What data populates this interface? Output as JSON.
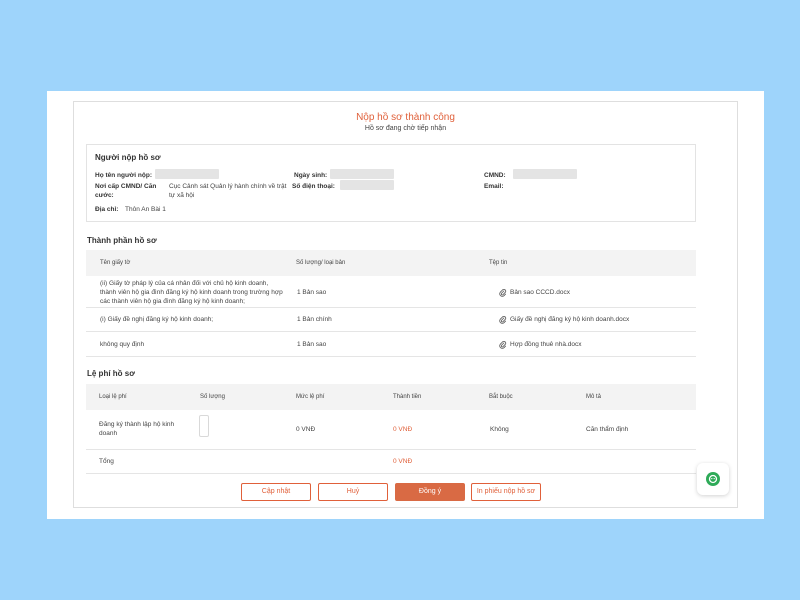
{
  "header": {
    "title": "Nộp hồ sơ thành công",
    "subtitle": "Hồ sơ đang chờ tiếp nhận"
  },
  "applicant": {
    "heading": "Người nộp hồ sơ",
    "name_label": "Họ tên người nộp:",
    "dob_label": "Ngày sinh:",
    "id_label": "CMND:",
    "issuer_label": "Nơi cấp CMND/ Căn cước:",
    "issuer_value": "Cục Cảnh sát Quản lý hành chính về trật tự xã hội",
    "phone_label": "Số điện thoại:",
    "email_label": "Email:",
    "address_label": "Địa chỉ:",
    "address_value": "Thôn An Bài 1"
  },
  "documents": {
    "heading": "Thành phần hồ sơ",
    "columns": [
      "Tên giấy tờ",
      "Số lượng/ loại bản",
      "Tệp tin"
    ],
    "rows": [
      {
        "name": "(ii) Giấy tờ pháp lý của cá nhân đối với chủ hộ kinh doanh, thành viên hộ gia đình đăng ký hộ kinh doanh trong trường hợp các thành viên hộ gia đình đăng ký hộ kinh doanh;",
        "name_line1": "(ii) Giấy tờ pháp lý của cá nhân đối với chủ hộ kinh doanh,",
        "name_line2": "thành viên hộ gia đình đăng ký hộ kinh doanh trong trường hợp",
        "name_line3": "các thành viên hộ gia đình đăng ký hộ kinh doanh;",
        "quantity": "1 Bản sao",
        "file": "Bản sao CCCD.docx"
      },
      {
        "name": "(i) Giấy đề nghị đăng ký hộ kinh doanh;",
        "quantity": "1 Bản chính",
        "file": "Giấy đề nghị đăng ký hộ kinh doanh.docx"
      },
      {
        "name": "không quy định",
        "quantity": "1 Bản sao",
        "file": "Hợp đồng thuê nhà.docx"
      }
    ]
  },
  "fees": {
    "heading": "Lệ phí hồ sơ",
    "columns": [
      "Loại lệ phí",
      "Số lượng",
      "Mức lệ phí",
      "Thành tiền",
      "Bắt buộc",
      "Mô tả"
    ],
    "row": {
      "type_line1": "Đăng ký thành lập hộ kinh",
      "type_line2": "doanh",
      "rate": "0 VNĐ",
      "amount": "0 VNĐ",
      "required": "Không",
      "description": "Căn thẩm định"
    },
    "total_label": "Tổng",
    "total_value": "0 VNĐ"
  },
  "actions": {
    "update": "Cập nhật",
    "cancel": "Huỷ",
    "agree": "Đồng ý",
    "print": "In phiếu nộp hồ sơ"
  },
  "colors": {
    "accent": "#e0603a",
    "primary_button": "#d96a44",
    "background": "#9ed4fb",
    "chat": "#2eaa58"
  },
  "icons": {
    "attachment": "paperclip-icon",
    "chat": "chat-bubble-icon"
  }
}
